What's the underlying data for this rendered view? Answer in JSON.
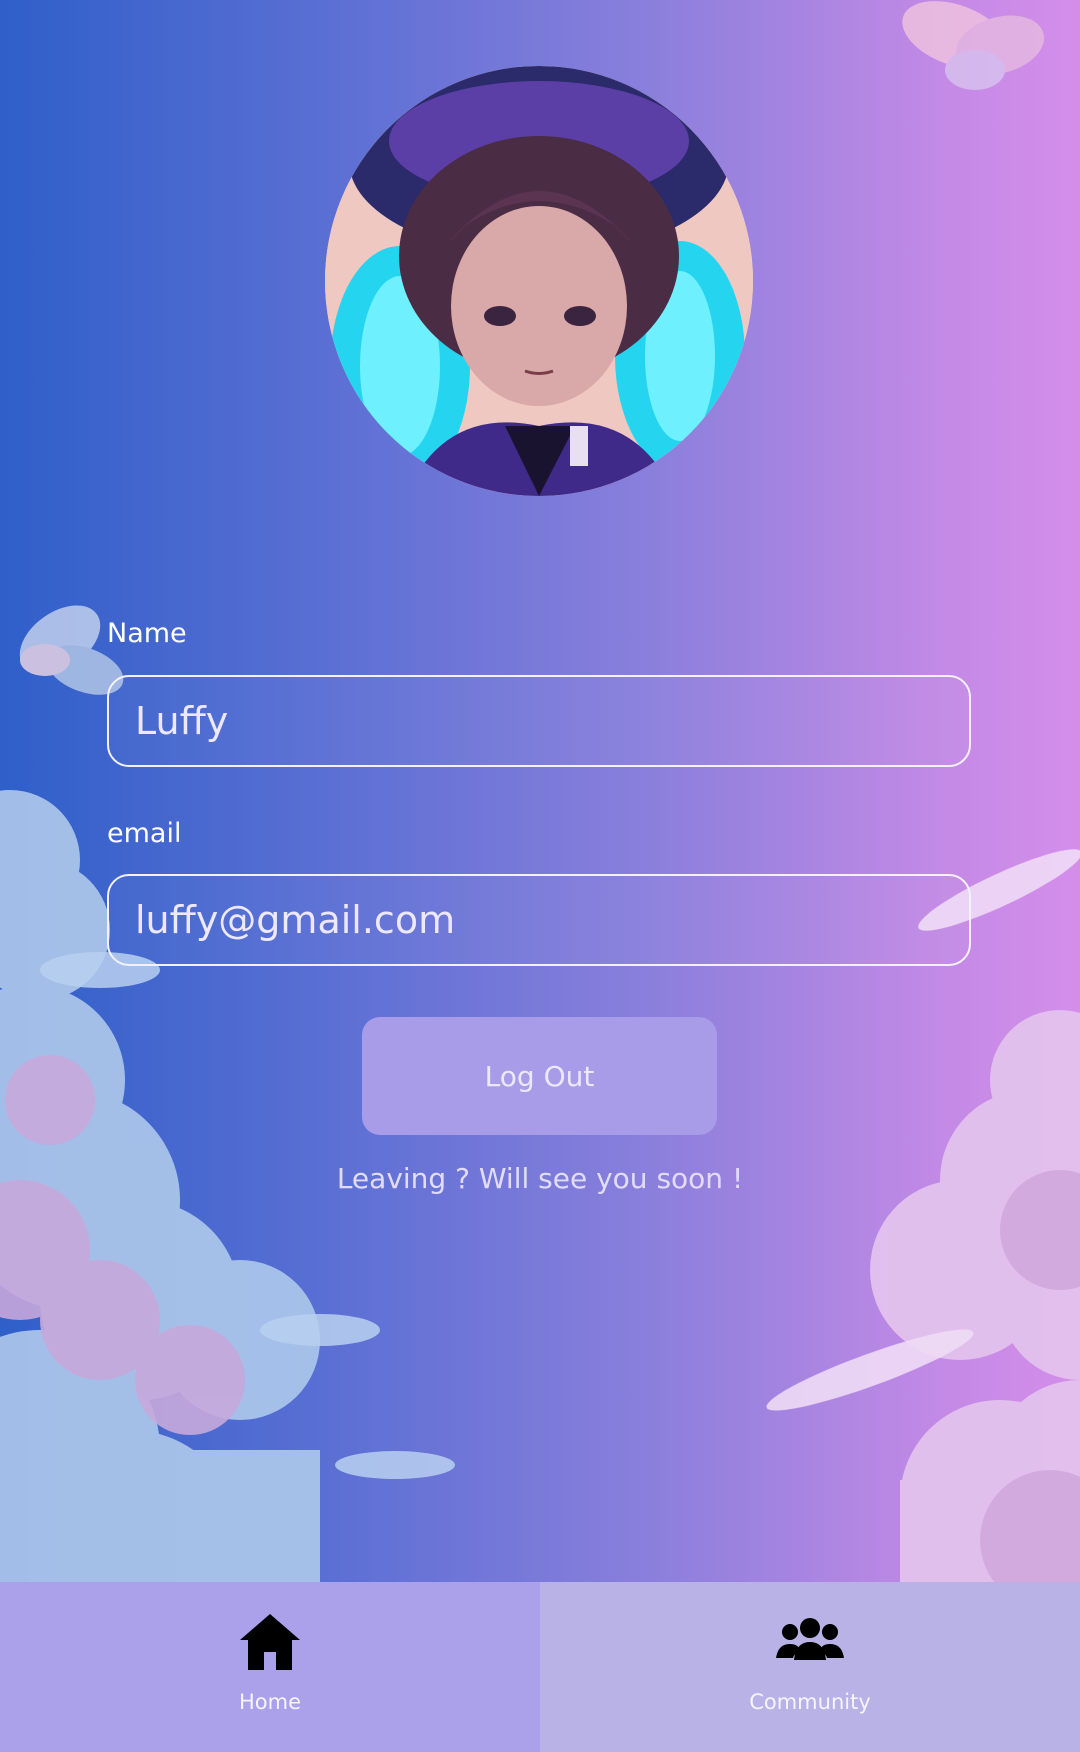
{
  "profile": {
    "avatar_icon": "anime-avatar"
  },
  "form": {
    "name_label": "Name",
    "name_value": "Luffy",
    "email_label": "email",
    "email_value": "luffy@gmail.com"
  },
  "actions": {
    "logout_label": "Log Out",
    "farewell_text": "Leaving ? Will see you soon !"
  },
  "nav": {
    "items": [
      {
        "label": "Home",
        "icon": "home-icon"
      },
      {
        "label": "Community",
        "icon": "group-icon"
      }
    ]
  },
  "colors": {
    "gradient_start": "#2f5fc9",
    "gradient_end": "#d48eea",
    "button": "#a89be8",
    "nav_home": "#aba0ea",
    "nav_community": "#b9b2e6"
  }
}
